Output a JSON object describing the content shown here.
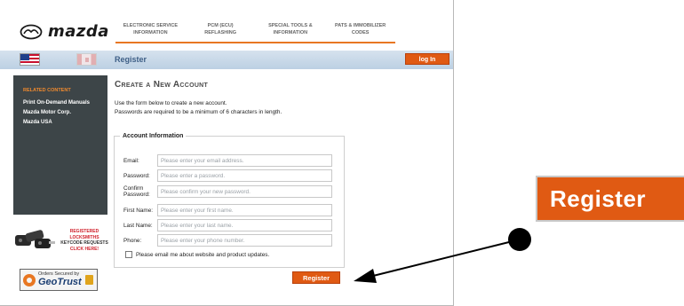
{
  "brand": {
    "name": "mazda",
    "accent": "#e87722",
    "button_color": "#e05a13"
  },
  "topnav": [
    {
      "line1": "Electronic Service",
      "line2": "Information"
    },
    {
      "line1": "PCM (ECU)",
      "line2": "Reflashing"
    },
    {
      "line1": "Special Tools &",
      "line2": "Information"
    },
    {
      "line1": "PATS & Immobilizer",
      "line2": "Codes"
    }
  ],
  "header": {
    "section_title": "Register",
    "login_label": "log In"
  },
  "sidebar": {
    "related_title": "Related Content",
    "links": [
      "Print On-Demand Manuals",
      "Mazda Motor Corp.",
      "Mazda USA"
    ],
    "locksmith": {
      "line1": "REGISTERED",
      "line2": "LOCKSMITHS",
      "line3": "KEYCODE REQUESTS",
      "line4": "CLICK HERE!"
    },
    "geotrust": {
      "top": "Orders Secured by",
      "main": "GeoTrust"
    }
  },
  "main": {
    "title": "Create a New Account",
    "intro_line1": "Use the form below to create a new account.",
    "intro_line2": "Passwords are required to be a minimum of 6 characters in length.",
    "fieldset_legend": "Account Information",
    "fields": [
      {
        "label": "Email:",
        "placeholder": "Please enter your email address."
      },
      {
        "label": "Password:",
        "placeholder": "Please enter a password."
      },
      {
        "label": "Confirm Password:",
        "placeholder": "Please confirm your new password."
      },
      {
        "label": "First Name:",
        "placeholder": "Please enter your first name."
      },
      {
        "label": "Last Name:",
        "placeholder": "Please enter your last name."
      },
      {
        "label": "Phone:",
        "placeholder": "Please enter your phone number."
      }
    ],
    "checkbox_label": "Please email me about website and product updates.",
    "register_label": "Register"
  },
  "callout": {
    "register_zoom_label": "Register"
  },
  "icons": [
    "mazda-logo-icon",
    "us-flag-icon",
    "canada-flag-icon",
    "keys-icon",
    "geotrust-icon",
    "lock-icon"
  ]
}
